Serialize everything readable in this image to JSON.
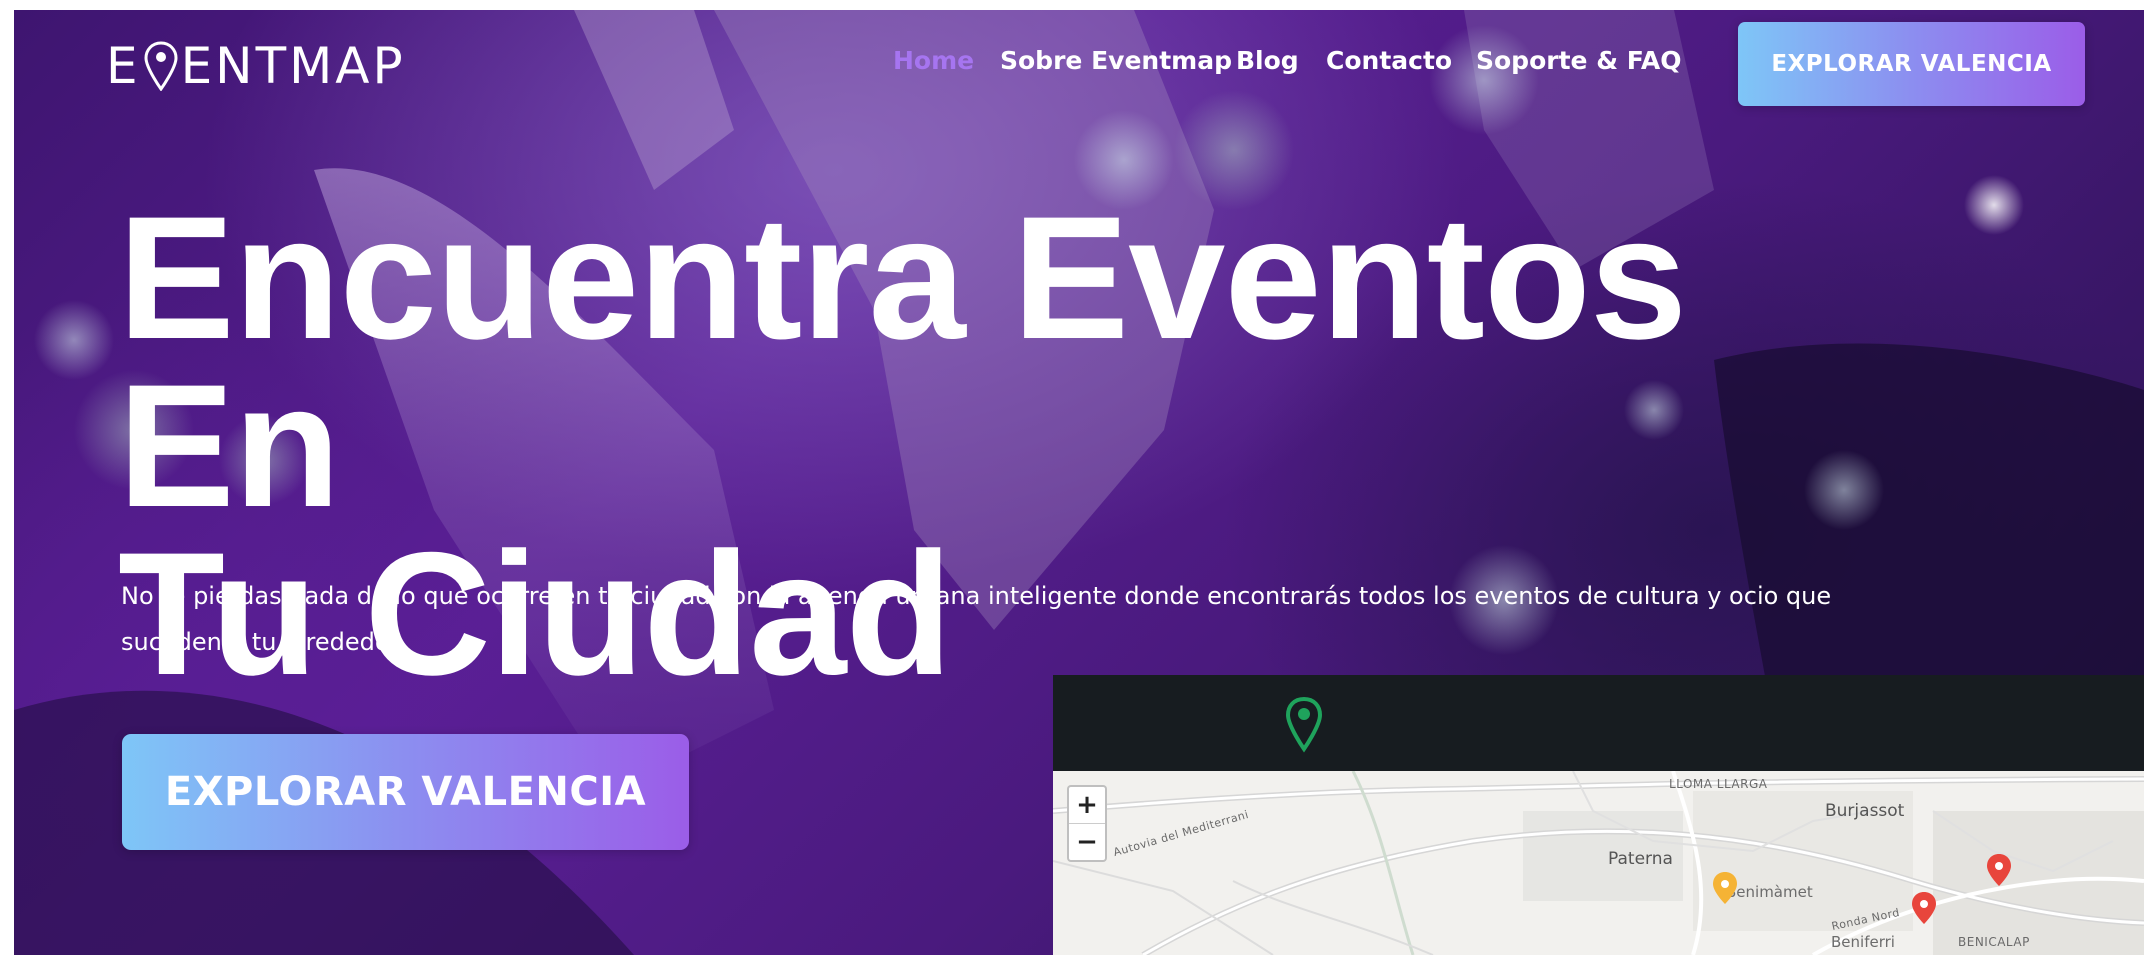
{
  "brand": {
    "name": "EVENTMAP"
  },
  "nav": {
    "items": [
      {
        "label": "Home",
        "active": true
      },
      {
        "label": "Sobre Eventmap",
        "active": false
      },
      {
        "label": "Blog",
        "active": false
      },
      {
        "label": "Contacto",
        "active": false
      },
      {
        "label": "Soporte & FAQ",
        "active": false
      }
    ],
    "cta_label": "EXPLORAR VALENCIA"
  },
  "hero": {
    "headline_line1": "Encuentra Eventos En",
    "headline_line2": "Tu Ciudad",
    "subtitle": "No te pierdas nada de lo que ocurre en tu ciudad con la agenda urbana inteligente donde encontrarás todos los eventos de cultura y ocio que suceden a tu alrededor",
    "cta_label": "EXPLORAR VALENCIA"
  },
  "map_preview": {
    "zoom_in": "+",
    "zoom_out": "−",
    "labels": {
      "lloma_llarga": "LLOMA LLARGA",
      "burjassot": "Burjassot",
      "paterna": "Paterna",
      "benimamet": "Benimàmet",
      "beniferri": "Beniferri",
      "benicalap": "BENICALAP",
      "ronda_nord": "Ronda Nord",
      "autovia": "Autovia del Mediterrani"
    },
    "markers": [
      {
        "color": "#f5b335"
      },
      {
        "color": "#e8453c"
      },
      {
        "color": "#e8453c"
      }
    ]
  },
  "colors": {
    "accent": "#a675f0",
    "button_gradient_start": "#7ec6f7",
    "button_gradient_end": "#9b5de8",
    "map_logo_green": "#1fa35c",
    "map_topbar": "#171c20"
  }
}
